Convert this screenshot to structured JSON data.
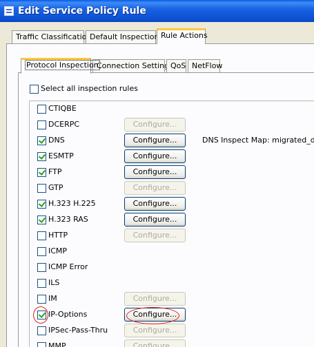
{
  "window": {
    "title": "Edit Service Policy Rule"
  },
  "outer_tabs": [
    {
      "label": "Traffic Classification"
    },
    {
      "label": "Default Inspections"
    },
    {
      "label": "Rule Actions"
    }
  ],
  "inner_tabs": [
    {
      "label": "Protocol Inspection"
    },
    {
      "label": "Connection Settings"
    },
    {
      "label": "QoS"
    },
    {
      "label": "NetFlow"
    }
  ],
  "select_all": {
    "label": "Select all inspection rules",
    "checked": false
  },
  "rules": [
    {
      "name": "CTIQBE",
      "checked": false,
      "button": null,
      "extra": ""
    },
    {
      "name": "DCERPC",
      "checked": false,
      "button": "Configure...",
      "button_enabled": false,
      "extra": ""
    },
    {
      "name": "DNS",
      "checked": true,
      "button": "Configure...",
      "button_enabled": true,
      "extra": "DNS Inspect Map: migrated_dns_m"
    },
    {
      "name": "ESMTP",
      "checked": true,
      "button": "Configure...",
      "button_enabled": true,
      "extra": ""
    },
    {
      "name": "FTP",
      "checked": true,
      "button": "Configure...",
      "button_enabled": true,
      "extra": ""
    },
    {
      "name": "GTP",
      "checked": false,
      "button": "Configure...",
      "button_enabled": false,
      "extra": ""
    },
    {
      "name": "H.323 H.225",
      "checked": true,
      "button": "Configure...",
      "button_enabled": true,
      "extra": ""
    },
    {
      "name": "H.323 RAS",
      "checked": true,
      "button": "Configure...",
      "button_enabled": true,
      "extra": ""
    },
    {
      "name": "HTTP",
      "checked": false,
      "button": "Configure...",
      "button_enabled": false,
      "extra": ""
    },
    {
      "name": "ICMP",
      "checked": false,
      "button": null,
      "extra": ""
    },
    {
      "name": "ICMP Error",
      "checked": false,
      "button": null,
      "extra": ""
    },
    {
      "name": "ILS",
      "checked": false,
      "button": null,
      "extra": ""
    },
    {
      "name": "IM",
      "checked": false,
      "button": "Configure...",
      "button_enabled": false,
      "extra": ""
    },
    {
      "name": "IP-Options",
      "checked": true,
      "button": "Configure...",
      "button_enabled": true,
      "extra": ""
    },
    {
      "name": "IPSec-Pass-Thru",
      "checked": false,
      "button": "Configure...",
      "button_enabled": false,
      "extra": ""
    },
    {
      "name": "MMP",
      "checked": false,
      "button": "Configure...",
      "button_enabled": false,
      "extra": ""
    }
  ],
  "colors": {
    "titlebar": "#0a5be8",
    "active_tab_highlight": "#ffc83c",
    "check": "#21a121",
    "annotation": "#e02020"
  }
}
